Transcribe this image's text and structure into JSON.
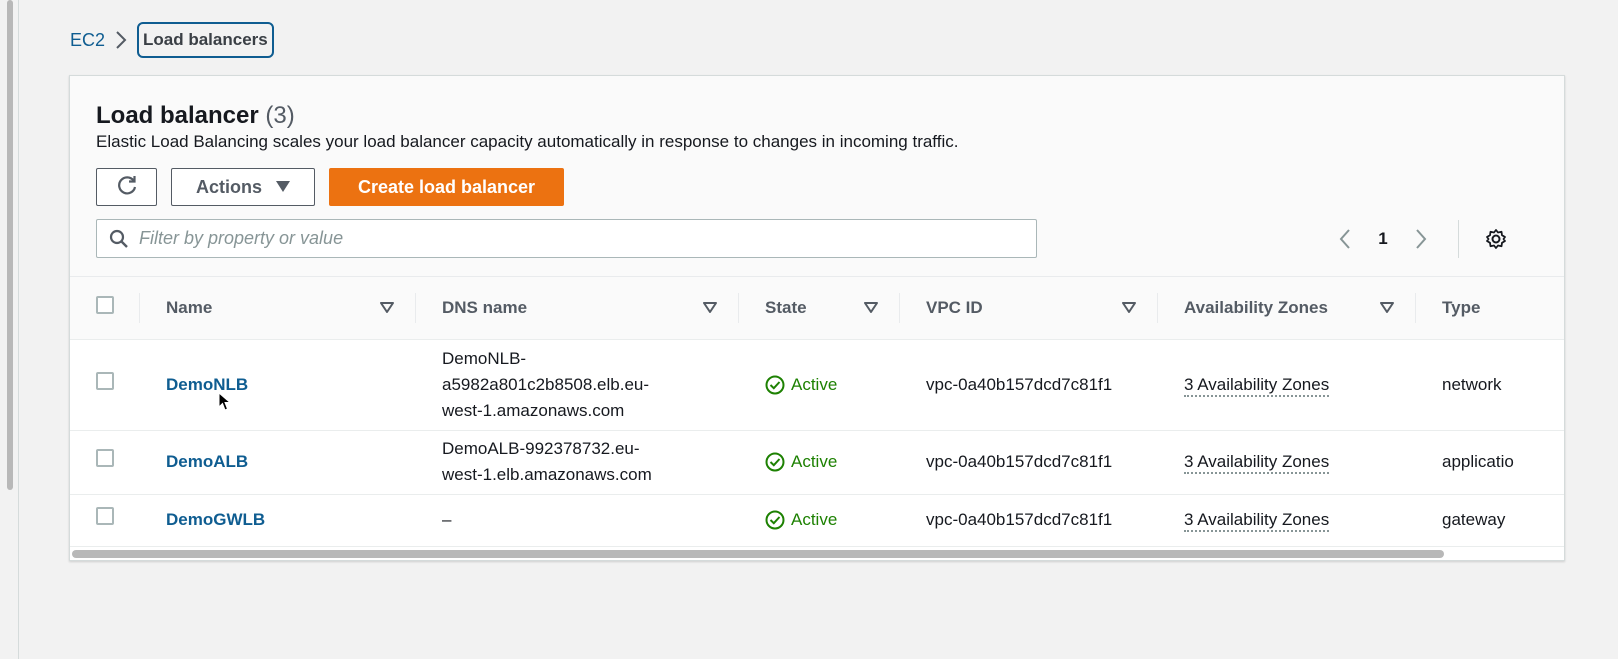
{
  "breadcrumb": {
    "root": "EC2",
    "current": "Load balancers"
  },
  "panel": {
    "title": "Load balancer",
    "count": "(3)",
    "description": "Elastic Load Balancing scales your load balancer capacity automatically in response to changes in incoming traffic.",
    "actions_label": "Actions",
    "create_label": "Create load balancer",
    "filter_placeholder": "Filter by property or value",
    "page_number": "1"
  },
  "table": {
    "columns": [
      "Name",
      "DNS name",
      "State",
      "VPC ID",
      "Availability Zones",
      "Type"
    ],
    "rows": [
      {
        "name": "DemoNLB",
        "dns_lines": [
          "DemoNLB-",
          "a5982a801c2b8508.elb.eu-",
          "west-1.amazonaws.com"
        ],
        "state": "Active",
        "vpc": "vpc-0a40b157dcd7c81f1",
        "az": "3 Availability Zones",
        "type": "network"
      },
      {
        "name": "DemoALB",
        "dns_lines": [
          "DemoALB-992378732.eu-",
          "west-1.elb.amazonaws.com"
        ],
        "state": "Active",
        "vpc": "vpc-0a40b157dcd7c81f1",
        "az": "3 Availability Zones",
        "type": "applicatio"
      },
      {
        "name": "DemoGWLB",
        "dns_lines": [
          "–"
        ],
        "state": "Active",
        "vpc": "vpc-0a40b157dcd7c81f1",
        "az": "3 Availability Zones",
        "type": "gateway"
      }
    ]
  },
  "colors": {
    "link": "#0f5d91",
    "primary_button": "#ec7211",
    "status_active": "#1d8102"
  },
  "icons": {
    "refresh": "refresh-icon",
    "dropdown": "caret-down-icon",
    "search": "search-icon",
    "prev": "chevron-left-icon",
    "next": "chevron-right-icon",
    "settings": "gear-icon",
    "sort": "sort-caret-icon",
    "status": "check-circle-icon"
  }
}
